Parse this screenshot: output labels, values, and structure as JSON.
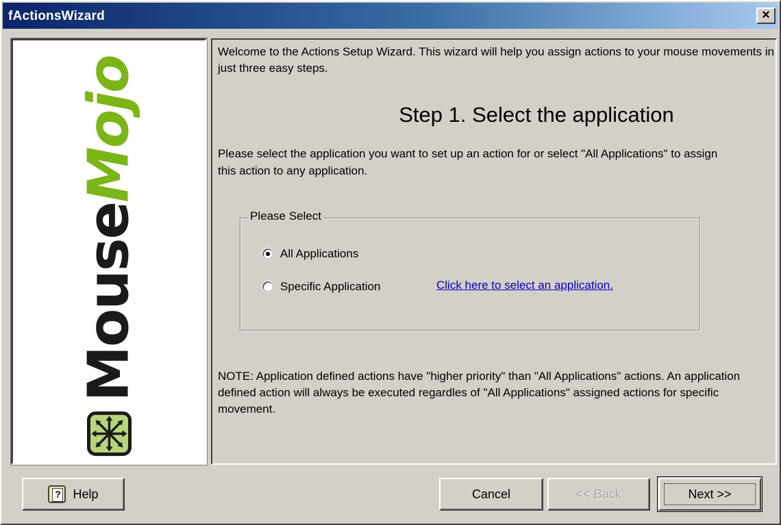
{
  "window": {
    "title": "fActionsWizard",
    "close_label": "×"
  },
  "logo": {
    "word1": "Mouse",
    "word2": "Mojo",
    "icon": "mousemojo-arrows-icon",
    "color_dark": "#1a1a1a",
    "color_accent": "#7cb518"
  },
  "content": {
    "intro": "Welcome to the Actions Setup Wizard. This wizard will help you assign actions to your mouse movements in just three easy steps.",
    "step_title": "Step 1. Select the application",
    "instructions": "Please select the application you want to set up an action for or select \"All Applications\" to assign this action to any application.",
    "group": {
      "legend": "Please Select",
      "options": [
        {
          "label": "All Applications",
          "checked": true
        },
        {
          "label": "Specific Application",
          "checked": false
        }
      ],
      "link": "Click here to select an application."
    },
    "note": "NOTE: Application defined actions have \"higher priority\" than \"All Applications\" actions. An application defined action will always be executed regardles  of \"All Applications\" assigned actions for specific movement."
  },
  "buttons": {
    "help": "Help",
    "help_icon": "help-book-icon",
    "cancel": "Cancel",
    "back": "<< Back",
    "next": "Next >>"
  }
}
